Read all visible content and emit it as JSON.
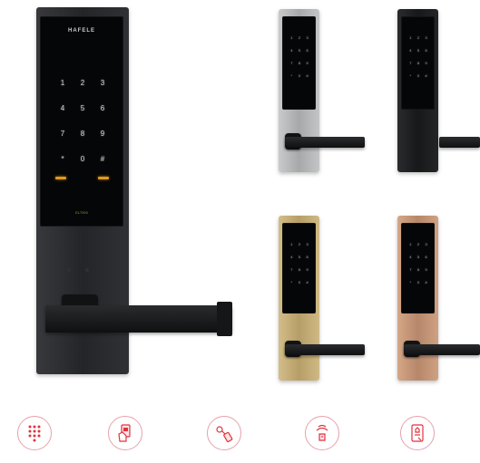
{
  "main_lock": {
    "brand": "HAFELE",
    "keypad": [
      "1",
      "2",
      "3",
      "4",
      "5",
      "6",
      "7",
      "8",
      "9",
      "*",
      "0",
      "#"
    ],
    "model": "EL7000"
  },
  "variants": [
    {
      "finish": "silver",
      "color": "#b9bbbd"
    },
    {
      "finish": "black",
      "color": "#1a1b1d"
    },
    {
      "finish": "gold",
      "color": "#c7b07a"
    },
    {
      "finish": "rose-gold",
      "color": "#c69878"
    }
  ],
  "features": [
    {
      "icon": "keypad-icon"
    },
    {
      "icon": "card-icon"
    },
    {
      "icon": "key-icon"
    },
    {
      "icon": "fingerprint-icon"
    },
    {
      "icon": "mobile-app-icon"
    }
  ],
  "colors": {
    "accent": "#e1323e",
    "main_plate": "#2c2d30"
  }
}
